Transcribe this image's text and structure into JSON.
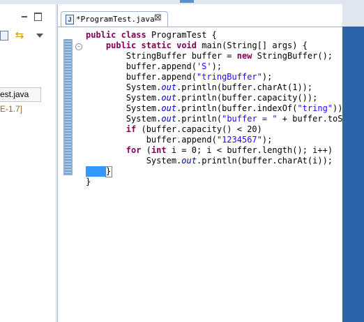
{
  "editor": {
    "tab_title": "*ProgramTest.java",
    "tab_icon": "J",
    "close_glyph": "⊠"
  },
  "explorer": {
    "file_item": "est.java",
    "jre_item": "E-1.7]",
    "icons": [
      "minimize-icon",
      "maximize-icon",
      "collapse-all-icon",
      "link-with-editor-icon",
      "view-menu-icon"
    ]
  },
  "code_lines": [
    [
      {
        "t": "public",
        "c": "kw"
      },
      {
        "t": " "
      },
      {
        "t": "class",
        "c": "kw"
      },
      {
        "t": " ProgramTest {"
      }
    ],
    [
      {
        "t": "    "
      },
      {
        "t": "public",
        "c": "kw"
      },
      {
        "t": " "
      },
      {
        "t": "static",
        "c": "kw"
      },
      {
        "t": " "
      },
      {
        "t": "void",
        "c": "kw"
      },
      {
        "t": " main(String[] args) {"
      }
    ],
    [
      {
        "t": "        StringBuffer buffer = "
      },
      {
        "t": "new",
        "c": "kw"
      },
      {
        "t": " StringBuffer();"
      }
    ],
    [
      {
        "t": "        buffer.append("
      },
      {
        "t": "'S'",
        "c": "str"
      },
      {
        "t": ");"
      }
    ],
    [
      {
        "t": "        buffer.append("
      },
      {
        "t": "\"tringBuffer\"",
        "c": "str"
      },
      {
        "t": ");"
      }
    ],
    [
      {
        "t": "        System."
      },
      {
        "t": "out",
        "c": "it"
      },
      {
        "t": ".println(buffer.charAt(1));"
      }
    ],
    [
      {
        "t": "        System."
      },
      {
        "t": "out",
        "c": "it"
      },
      {
        "t": ".println(buffer.capacity());"
      }
    ],
    [
      {
        "t": "        System."
      },
      {
        "t": "out",
        "c": "it"
      },
      {
        "t": ".println(buffer.indexOf("
      },
      {
        "t": "\"tring\"",
        "c": "str"
      },
      {
        "t": "));"
      }
    ],
    [
      {
        "t": "        System."
      },
      {
        "t": "out",
        "c": "it"
      },
      {
        "t": ".println("
      },
      {
        "t": "\"buffer = \"",
        "c": "str"
      },
      {
        "t": " + buffer.toStr"
      }
    ],
    [
      {
        "t": "        "
      },
      {
        "t": "if",
        "c": "kw"
      },
      {
        "t": " (buffer.capacity() < 20)"
      }
    ],
    [
      {
        "t": "            buffer.append("
      },
      {
        "t": "\"1234567\"",
        "c": "str"
      },
      {
        "t": ");"
      }
    ],
    [
      {
        "t": "        "
      },
      {
        "t": "for",
        "c": "kw"
      },
      {
        "t": " ("
      },
      {
        "t": "int",
        "c": "kw"
      },
      {
        "t": " i = 0; i < buffer.length(); i++)"
      }
    ],
    [
      {
        "t": "            System."
      },
      {
        "t": "out",
        "c": "it"
      },
      {
        "t": ".println(buffer.charAt(i));"
      }
    ],
    [
      {
        "t": "    }"
      }
    ],
    [
      {
        "t": "}"
      }
    ]
  ],
  "colors": {
    "keyword": "#7f0055",
    "string": "#2a00ff",
    "static_field": "#0000c0",
    "current_line_highlight": "#3399ff",
    "ruler": "#8fb3d6"
  }
}
